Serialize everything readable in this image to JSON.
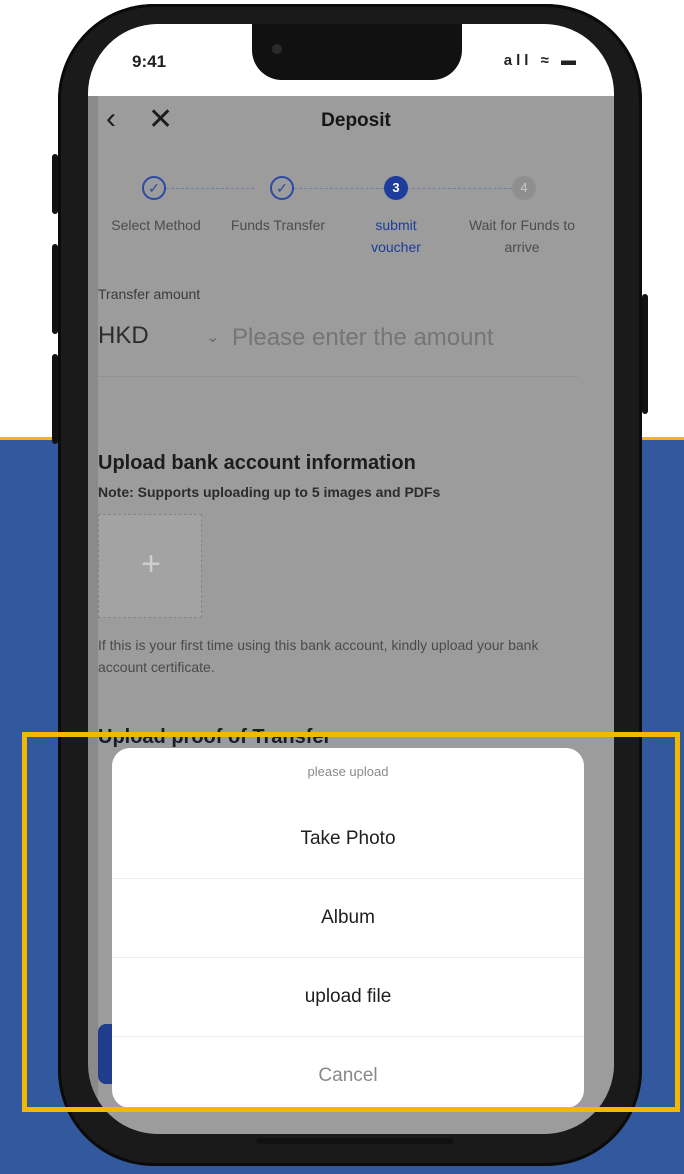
{
  "status_bar": {
    "time": "9:41",
    "icons": "all ≈ ▬"
  },
  "nav": {
    "back_icon": "chevron-left",
    "close_icon": "close",
    "title": "Deposit"
  },
  "steps": [
    {
      "label": "Select Method",
      "state": "done"
    },
    {
      "label": "Funds Transfer",
      "state": "done"
    },
    {
      "label": "submit voucher",
      "number": "3",
      "state": "active"
    },
    {
      "label": "Wait for Funds to arrive",
      "number": "4",
      "state": "todo"
    }
  ],
  "amount": {
    "label": "Transfer amount",
    "currency": "HKD",
    "placeholder": "Please enter the amount"
  },
  "bank_section": {
    "title": "Upload bank account information",
    "note": "Note: Supports uploading up to 5 images and PDFs",
    "hint": "If this is your first time using this bank account, kindly upload your bank account certificate."
  },
  "proof_section": {
    "title": "Upload proof of Transfer"
  },
  "action_sheet": {
    "title": "please upload",
    "options": [
      "Take Photo",
      "Album",
      "upload file"
    ],
    "cancel": "Cancel"
  },
  "colors": {
    "background_band": "#32589e",
    "highlight": "#f5b800",
    "accent": "#1d3c9b"
  }
}
